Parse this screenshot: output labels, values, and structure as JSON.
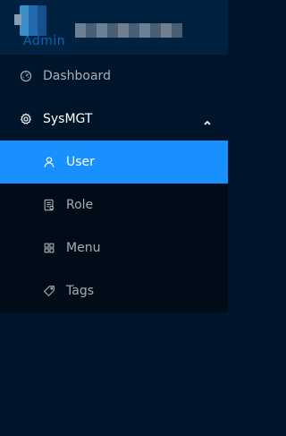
{
  "logo": {
    "title": "Admin"
  },
  "menu": {
    "dashboard": {
      "label": "Dashboard",
      "icon": "dashboard-icon"
    },
    "sysmgt": {
      "label": "SysMGT",
      "icon": "gear-icon",
      "expanded": true,
      "children": [
        {
          "label": "User",
          "icon": "user-icon",
          "selected": true
        },
        {
          "label": "Role",
          "icon": "role-icon",
          "selected": false
        },
        {
          "label": "Menu",
          "icon": "menu-grid-icon",
          "selected": false
        },
        {
          "label": "Tags",
          "icon": "tag-icon",
          "selected": false
        }
      ]
    }
  },
  "colors": {
    "sidebar_bg": "#001529",
    "submenu_bg": "#000c17",
    "selected_bg": "#1890ff"
  }
}
